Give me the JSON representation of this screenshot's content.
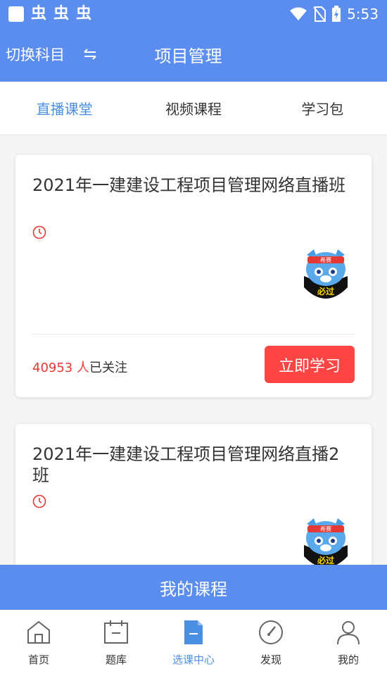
{
  "status_bar": {
    "time": "5:53",
    "app_glyph": "虫"
  },
  "header": {
    "switch_subject": "切换科目",
    "switch_icon": "swap-arrows-icon",
    "title": "项目管理"
  },
  "tabs": [
    {
      "label": "直播课堂",
      "active": true
    },
    {
      "label": "视频课程",
      "active": false
    },
    {
      "label": "学习包",
      "active": false
    }
  ],
  "courses": [
    {
      "title": "2021年一建建设工程项目管理网络直播班",
      "followers": "40953",
      "followers_unit": "人",
      "followers_suffix": "已关注",
      "button": "立即学习",
      "mascot_text_top": "希赛",
      "mascot_text_bottom": "必过"
    },
    {
      "title": "2021年一建建设工程项目管理网络直播2班",
      "mascot_text_top": "希赛",
      "mascot_text_bottom": "必过"
    }
  ],
  "my_courses_label": "我的课程",
  "nav": [
    {
      "label": "首页",
      "icon": "home-icon",
      "active": false
    },
    {
      "label": "题库",
      "icon": "calendar-icon",
      "active": false
    },
    {
      "label": "选课中心",
      "icon": "document-icon",
      "active": true
    },
    {
      "label": "发现",
      "icon": "compass-icon",
      "active": false
    },
    {
      "label": "我的",
      "icon": "user-icon",
      "active": false
    }
  ],
  "colors": {
    "primary": "#5b8def",
    "accent_text": "#4a90e2",
    "button": "#ff4444",
    "followers": "#e53935"
  }
}
